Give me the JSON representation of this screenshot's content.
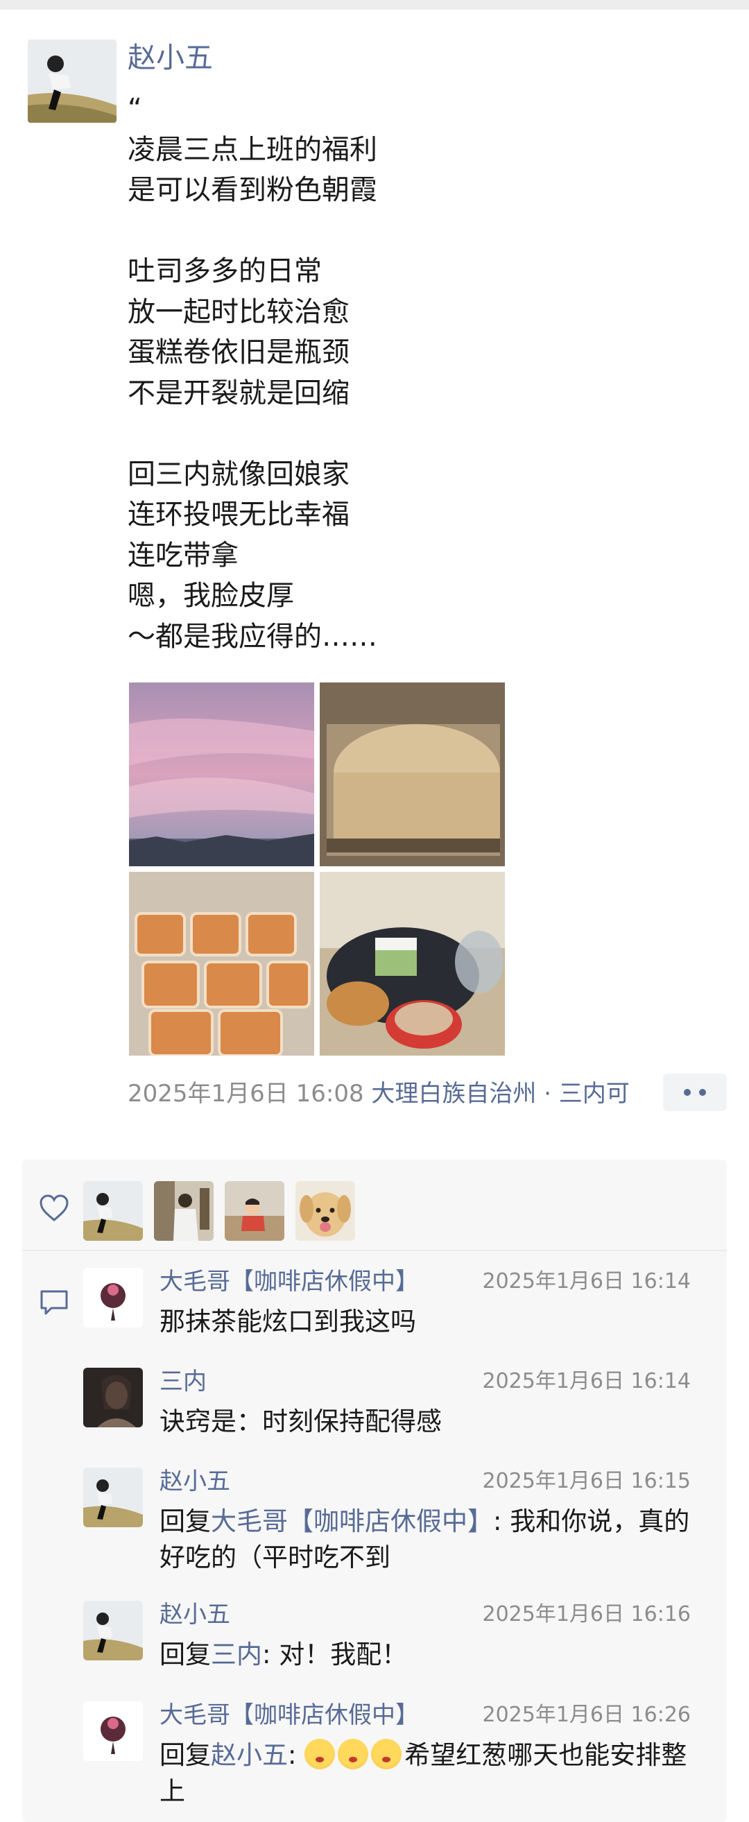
{
  "post": {
    "author": "赵小五",
    "text": "“\n凌晨三点上班的福利\n是可以看到粉色朝霞\n\n吐司多多的日常\n放一起时比较治愈\n蛋糕卷依旧是瓶颈\n不是开裂就是回缩\n\n回三内就像回娘家\n连环投喂无比幸福\n连吃带拿\n嗯，我脸皮厚\n～都是我应得的……",
    "time": "2025年1月6日 16:08",
    "location": "大理白族自治州 · 三内可"
  },
  "photos": [
    "pink-sky-photo",
    "toast-loaf-photo",
    "toast-tray-photo",
    "cake-coffee-photo"
  ],
  "likes": [
    "avatar-zhaoxiaowu",
    "avatar-person",
    "avatar-child",
    "avatar-dog"
  ],
  "comments": [
    {
      "name": "大毛哥【咖啡店休假中】",
      "time": "2025年1月6日 16:14",
      "text": "那抹茶能炫口到我这吗"
    },
    {
      "name": "三内",
      "time": "2025年1月6日 16:14",
      "text": "诀窍是：时刻保持配得感"
    },
    {
      "name": "赵小五",
      "time": "2025年1月6日 16:15",
      "prefix": "回复",
      "ref": "大毛哥【咖啡店休假中】",
      "text": ": 我和你说，真的好吃的（平时吃不到"
    },
    {
      "name": "赵小五",
      "time": "2025年1月6日 16:16",
      "prefix": "回复",
      "ref": "三内",
      "text": ": 对！我配！"
    },
    {
      "name": "大毛哥【咖啡店休假中】",
      "time": "2025年1月6日 16:26",
      "prefix": "回复",
      "ref": "赵小五",
      "text": "希望红葱哪天也能安排整上"
    }
  ],
  "colors": {
    "name_blue": "#576b95",
    "time_gray": "#8c8c8c",
    "panel_bg": "#f7f7f7"
  }
}
